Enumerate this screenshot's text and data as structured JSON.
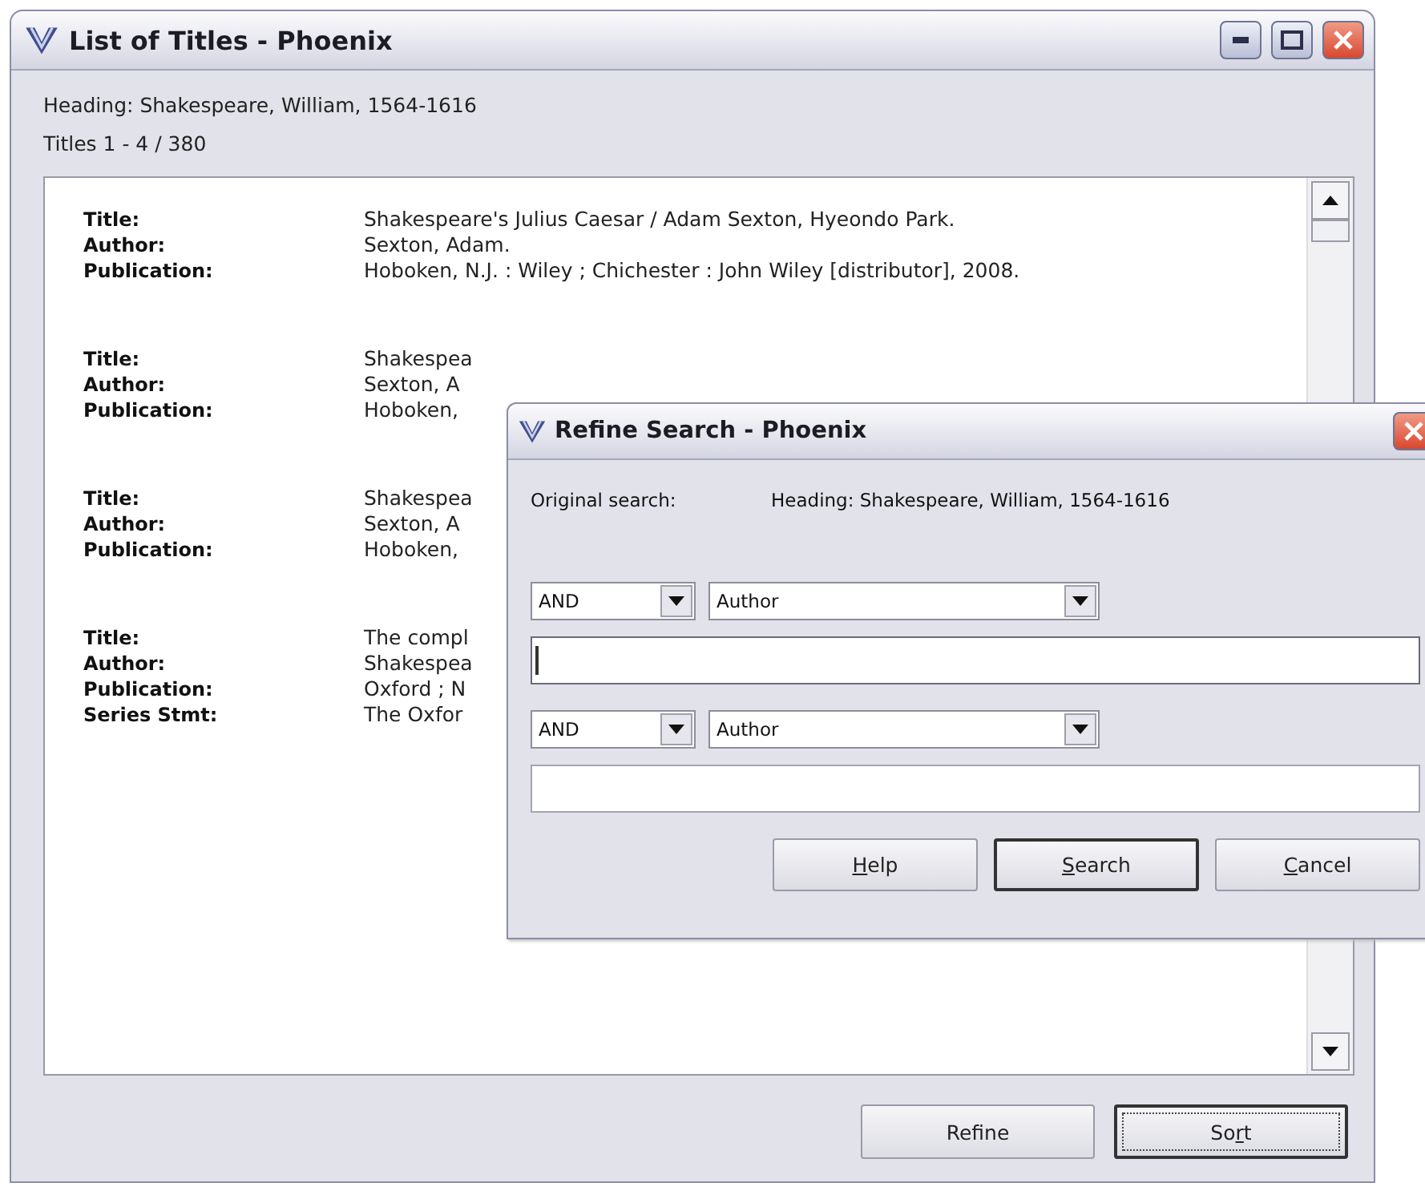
{
  "window": {
    "title": "List of Titles - Phoenix"
  },
  "heading": "Heading: Shakespeare, William, 1564-1616",
  "range": "Titles 1 - 4 / 380",
  "records": [
    {
      "fields": [
        {
          "label": "Title:",
          "value": "Shakespeare's Julius Caesar / Adam Sexton, Hyeondo Park."
        },
        {
          "label": "Author:",
          "value": "Sexton, Adam."
        },
        {
          "label": "Publication:",
          "value": "Hoboken, N.J. : Wiley ; Chichester : John Wiley [distributor], 2008."
        }
      ]
    },
    {
      "fields": [
        {
          "label": "Title:",
          "value": "Shakespea"
        },
        {
          "label": "Author:",
          "value": "Sexton, A"
        },
        {
          "label": "Publication:",
          "value": "Hoboken,"
        }
      ]
    },
    {
      "fields": [
        {
          "label": "Title:",
          "value": "Shakespea"
        },
        {
          "label": "Author:",
          "value": "Sexton, A"
        },
        {
          "label": "Publication:",
          "value": "Hoboken,"
        }
      ]
    },
    {
      "fields": [
        {
          "label": "Title:",
          "value": "The compl"
        },
        {
          "label": "Author:",
          "value": "Shakespea"
        },
        {
          "label": "Publication:",
          "value": "Oxford ; N"
        },
        {
          "label": "Series Stmt:",
          "value": "The Oxfor"
        }
      ]
    }
  ],
  "buttons": [
    {
      "label_parts": [
        {
          "text": "Refine",
          "underlined": false
        }
      ],
      "default": false,
      "focused": false
    },
    {
      "label_parts": [
        {
          "text": "So",
          "underlined": false
        },
        {
          "text": "r",
          "underlined": true
        },
        {
          "text": "t",
          "underlined": false
        }
      ],
      "default": true,
      "focused": true
    }
  ],
  "dialog": {
    "title": "Refine Search - Phoenix",
    "original_label": "Original search:",
    "original_value": "Heading: Shakespeare, William, 1564-1616",
    "criteria": [
      {
        "operator": "AND",
        "field": "Author",
        "focused": true
      },
      {
        "operator": "AND",
        "field": "Author",
        "focused": false
      }
    ],
    "buttons": [
      {
        "label_parts": [
          {
            "text": "H",
            "underlined": true
          },
          {
            "text": "elp",
            "underlined": false
          }
        ],
        "default": false
      },
      {
        "label_parts": [
          {
            "text": "S",
            "underlined": true
          },
          {
            "text": "earch",
            "underlined": false
          }
        ],
        "default": true
      },
      {
        "label_parts": [
          {
            "text": "C",
            "underlined": true
          },
          {
            "text": "ancel",
            "underlined": false
          }
        ],
        "default": false
      }
    ]
  }
}
